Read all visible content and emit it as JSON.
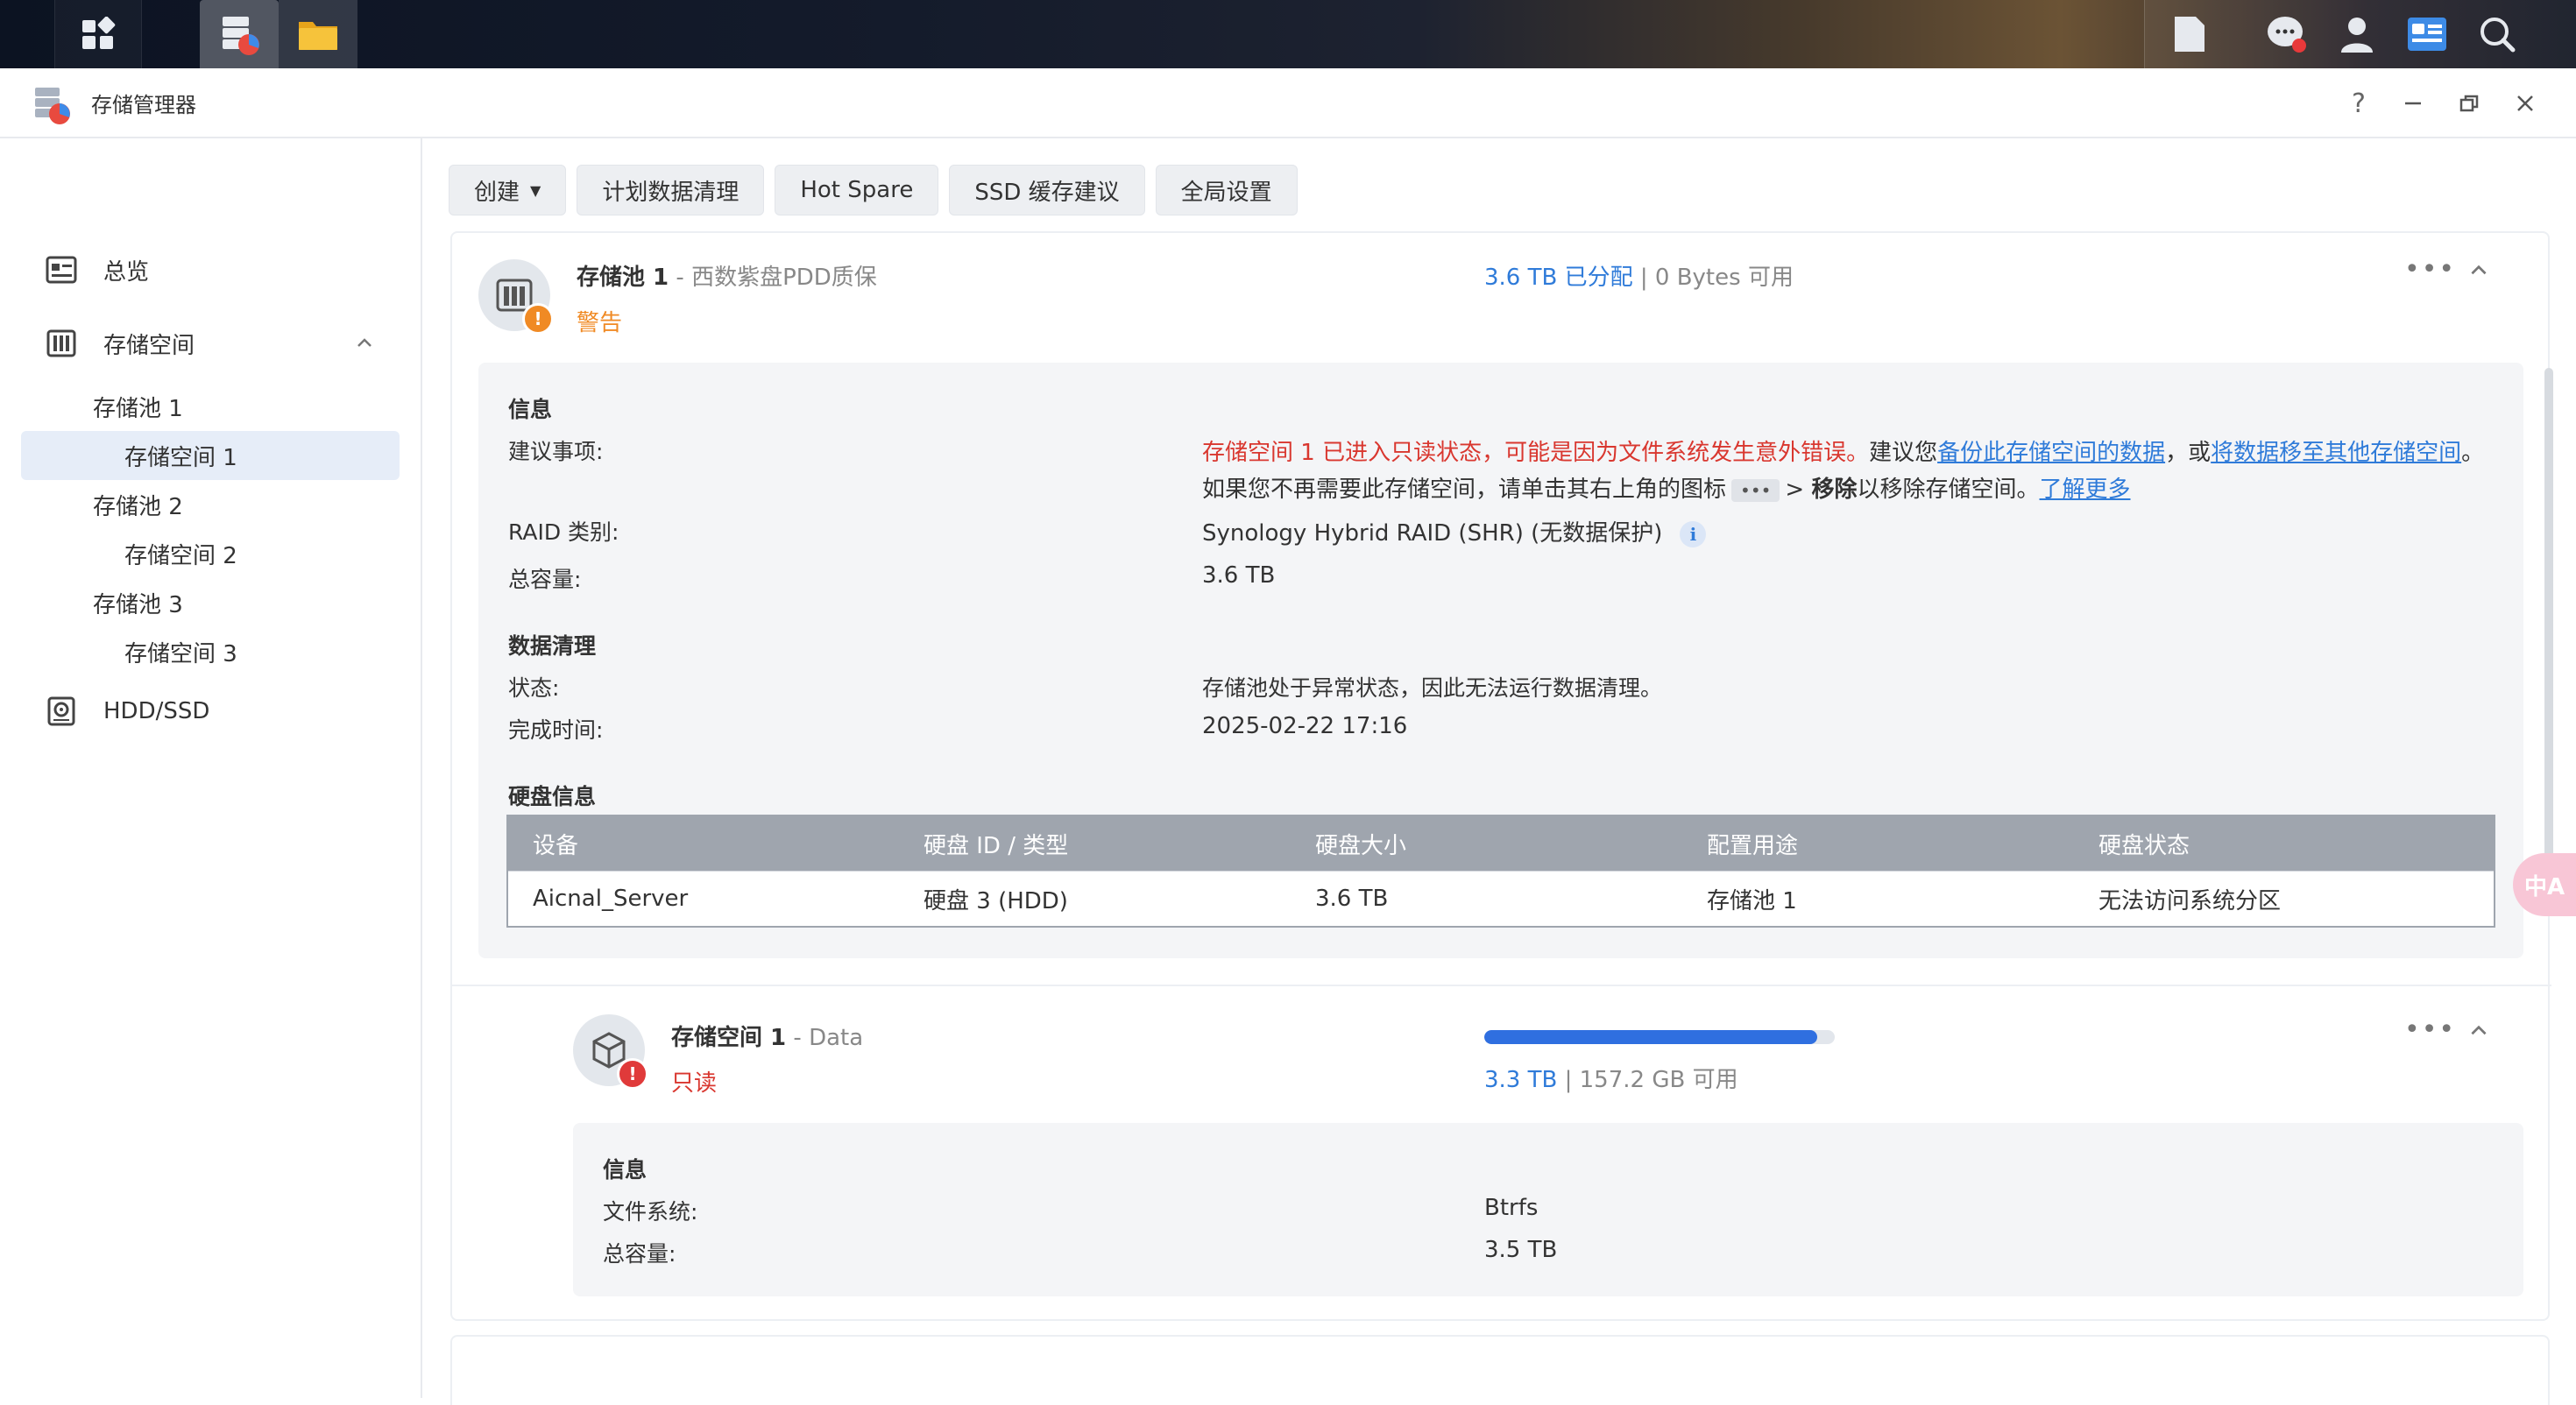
{
  "app": {
    "title": "存储管理器",
    "help": "?",
    "minimize": "—",
    "close": "✕"
  },
  "sidebar": {
    "overview": "总览",
    "storage": "存储空间",
    "pool1": "存储池 1",
    "volume1": "存储空间 1",
    "pool2": "存储池 2",
    "volume2": "存储空间 2",
    "pool3": "存储池 3",
    "volume3": "存储空间 3",
    "hdd": "HDD/SSD"
  },
  "toolbar": {
    "create": "创建",
    "scrub": "计划数据清理",
    "hotspare": "Hot Spare",
    "ssd": "SSD 缓存建议",
    "global": "全局设置"
  },
  "pool": {
    "name": "存储池 1",
    "desc": "西数紫盘PDD质保",
    "separator": "-",
    "status": "警告",
    "allocated": "3.6 TB 已分配",
    "divider": "|",
    "available": "0 Bytes 可用",
    "info_title": "信息",
    "advice_label": "建议事项:",
    "advice_red": "存储空间 1 已进入只读状态，可能是因为文件系统发生意外错误。",
    "advice_text1": "建议您",
    "advice_link1": "备份此存储空间的数据",
    "advice_text2": "，或",
    "advice_link2": "将数据移至其他存储空间",
    "advice_text3": "。",
    "advice_line2_a": "如果您不再需要此存储空间，请单击其右上角的图标",
    "advice_line2_pill": "•••",
    "advice_line2_b": "> ",
    "advice_line2_bold": "移除",
    "advice_line2_c": "以移除存储空间。",
    "advice_link3": "了解更多",
    "raid_label": "RAID 类别:",
    "raid_value": "Synology Hybrid RAID (SHR) (无数据保护)",
    "raid_info": "i",
    "capacity_label": "总容量:",
    "capacity_value": "3.6 TB",
    "scrub_title": "数据清理",
    "scrub_status_label": "状态:",
    "scrub_status_value": "存储池处于异常状态，因此无法运行数据清理。",
    "scrub_time_label": "完成时间:",
    "scrub_time_value": "2025-02-22 17:16",
    "disk_title": "硬盘信息",
    "disk_headers": [
      "设备",
      "硬盘 ID / 类型",
      "硬盘大小",
      "配置用途",
      "硬盘状态"
    ],
    "disk_row": [
      "Aicnal_Server",
      "硬盘 3 (HDD)",
      "3.6 TB",
      "存储池 1",
      "无法访问系统分区"
    ]
  },
  "volume": {
    "name": "存储空间 1",
    "separator": "-",
    "desc": "Data",
    "status": "只读",
    "used": "3.3 TB",
    "divider": "|",
    "available": "157.2 GB 可用",
    "usage_fraction": 0.95,
    "info_title": "信息",
    "fs_label": "文件系统:",
    "fs_value": "Btrfs",
    "capacity_label": "总容量:",
    "capacity_value": "3.5 TB"
  },
  "more": "•••",
  "translate_fab": "中A",
  "colors": {
    "accent": "#2f7bd9",
    "warning": "#f08a24",
    "error": "#d9372f"
  }
}
